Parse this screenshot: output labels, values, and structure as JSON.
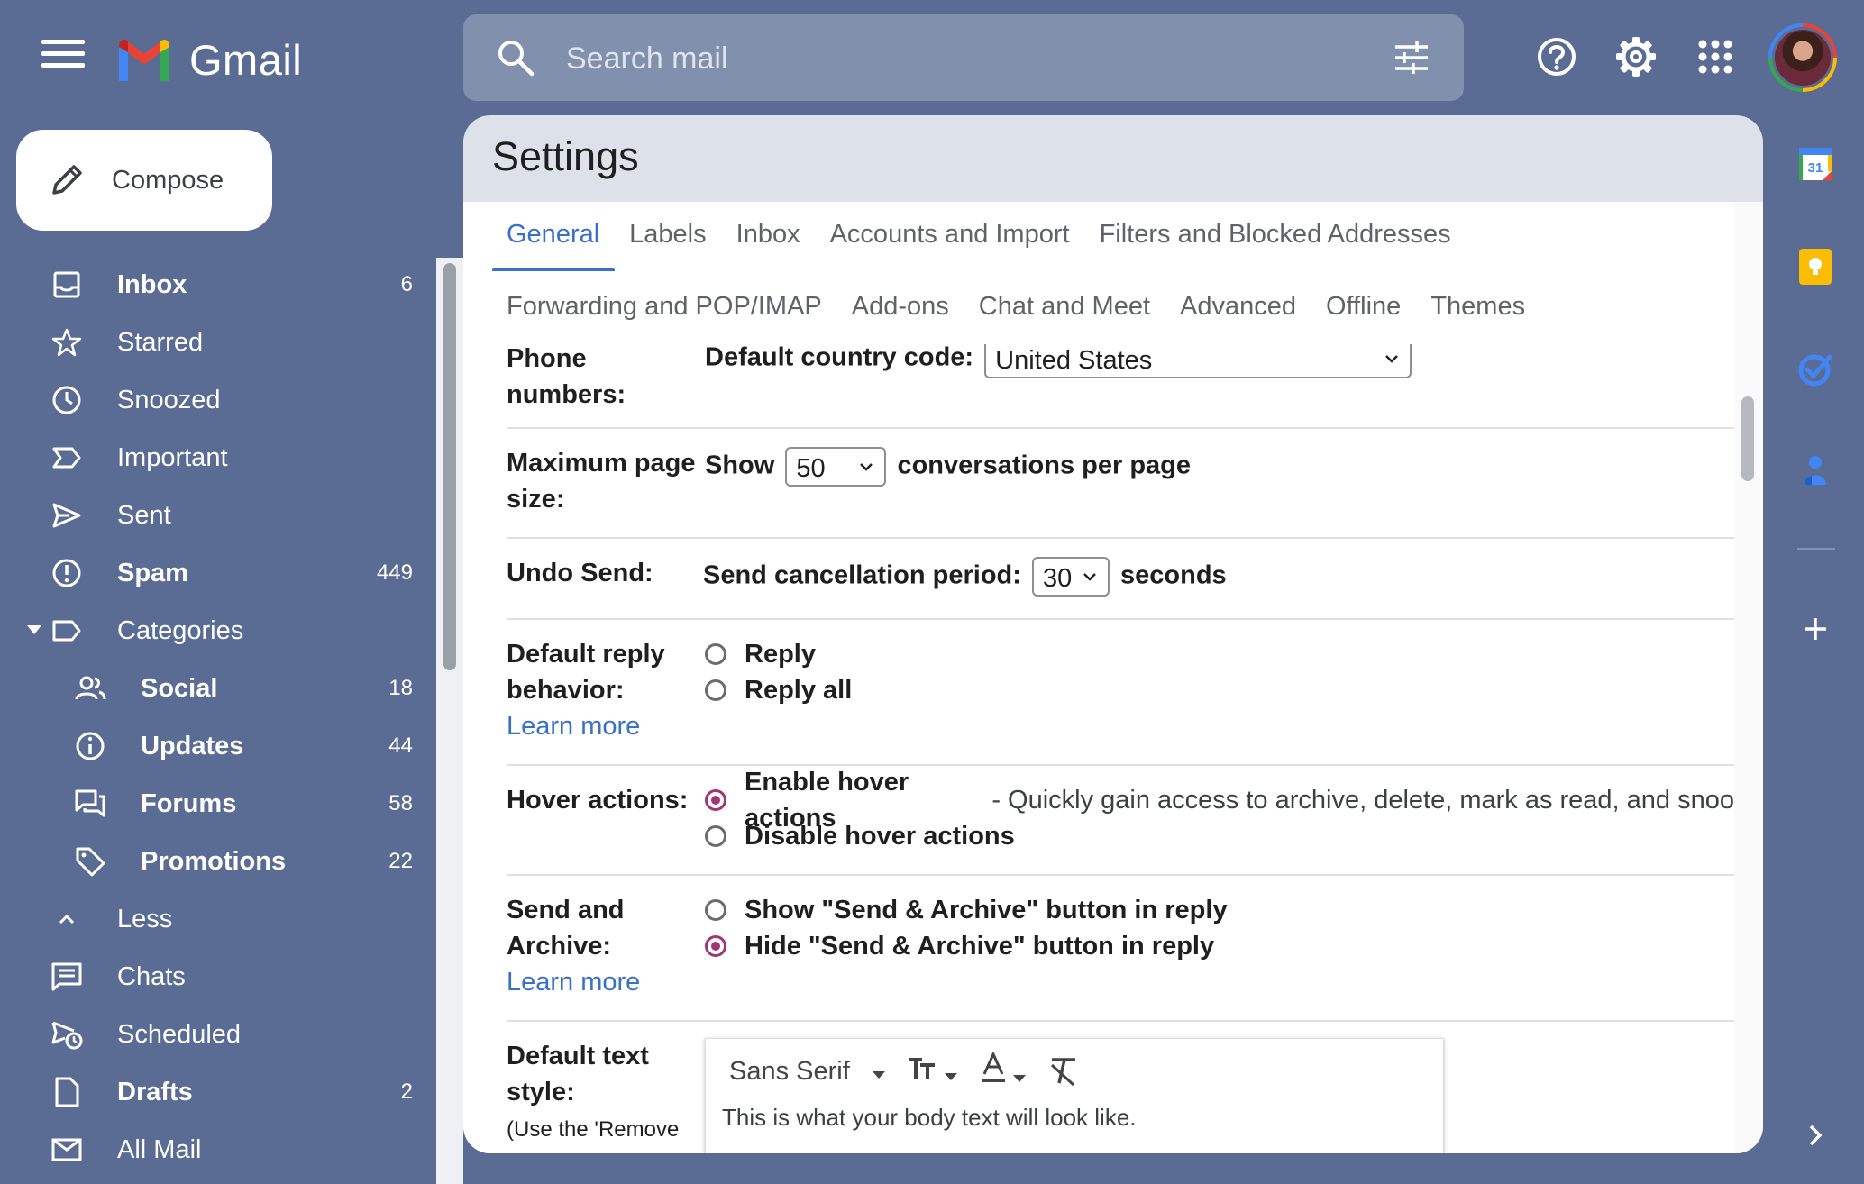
{
  "app": {
    "name": "Gmail"
  },
  "search": {
    "placeholder": "Search mail"
  },
  "compose": {
    "label": "Compose"
  },
  "nav": {
    "items": [
      {
        "label": "Inbox",
        "count": "6"
      },
      {
        "label": "Starred",
        "count": ""
      },
      {
        "label": "Snoozed",
        "count": ""
      },
      {
        "label": "Important",
        "count": ""
      },
      {
        "label": "Sent",
        "count": ""
      },
      {
        "label": "Spam",
        "count": "449"
      },
      {
        "label": "Categories",
        "count": ""
      },
      {
        "label": "Social",
        "count": "18"
      },
      {
        "label": "Updates",
        "count": "44"
      },
      {
        "label": "Forums",
        "count": "58"
      },
      {
        "label": "Promotions",
        "count": "22"
      },
      {
        "label": "Less",
        "count": ""
      },
      {
        "label": "Chats",
        "count": ""
      },
      {
        "label": "Scheduled",
        "count": ""
      },
      {
        "label": "Drafts",
        "count": "2"
      },
      {
        "label": "All Mail",
        "count": ""
      }
    ]
  },
  "settings": {
    "title": "Settings",
    "tabs_row1": [
      "General",
      "Labels",
      "Inbox",
      "Accounts and Import",
      "Filters and Blocked Addresses"
    ],
    "tabs_row2": [
      "Forwarding and POP/IMAP",
      "Add-ons",
      "Chat and Meet",
      "Advanced",
      "Offline",
      "Themes"
    ],
    "active_tab": "General",
    "phone": {
      "label": "Phone numbers:",
      "field_label": "Default country code:",
      "value": "United States"
    },
    "page_size": {
      "label": "Maximum page size:",
      "prefix": "Show",
      "value": "50",
      "suffix": "conversations per page"
    },
    "undo": {
      "label": "Undo Send:",
      "prefix": "Send cancellation period:",
      "value": "30",
      "suffix": "seconds"
    },
    "reply": {
      "label": "Default reply behavior:",
      "learn_more": "Learn more",
      "options": [
        "Reply",
        "Reply all"
      ],
      "selected": ""
    },
    "hover": {
      "label": "Hover actions:",
      "options": [
        "Enable hover actions",
        "Disable hover actions"
      ],
      "description": "- Quickly gain access to archive, delete, mark as read, and snoo",
      "selected": "Enable hover actions"
    },
    "send_archive": {
      "label": "Send and Archive:",
      "learn_more": "Learn more",
      "options": [
        "Show \"Send & Archive\" button in reply",
        "Hide \"Send & Archive\" button in reply"
      ],
      "selected": "Hide \"Send & Archive\" button in reply"
    },
    "text_style": {
      "label": "Default text style:",
      "hint": "(Use the 'Remove",
      "font": "Sans Serif",
      "preview": "This is what your body text will look like."
    }
  },
  "rail": {
    "calendar_day": "31"
  },
  "colors": {
    "background": "#5a6c93",
    "accent": "#3a70c7",
    "radio_selected": "#a1357a"
  }
}
